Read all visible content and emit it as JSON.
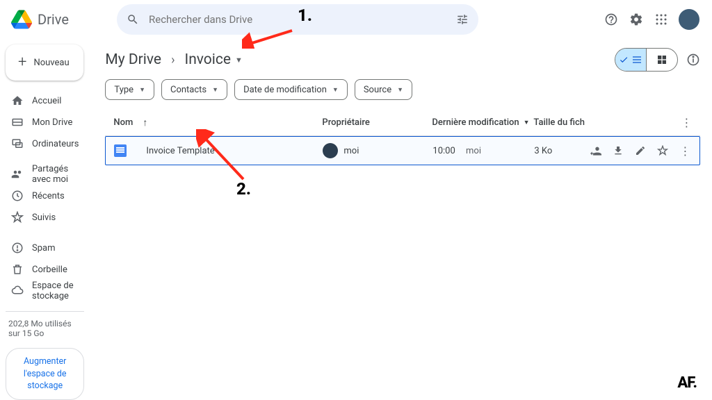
{
  "app": {
    "name": "Drive"
  },
  "search": {
    "placeholder": "Rechercher dans Drive"
  },
  "newButton": {
    "label": "Nouveau"
  },
  "sidebar": {
    "items": [
      {
        "label": "Accueil",
        "icon": "home-icon"
      },
      {
        "label": "Mon Drive",
        "icon": "drive-icon"
      },
      {
        "label": "Ordinateurs",
        "icon": "computers-icon"
      },
      {
        "label": "Partagés avec moi",
        "icon": "shared-icon"
      },
      {
        "label": "Récents",
        "icon": "recent-icon"
      },
      {
        "label": "Suivis",
        "icon": "starred-icon"
      },
      {
        "label": "Spam",
        "icon": "spam-icon"
      },
      {
        "label": "Corbeille",
        "icon": "trash-icon"
      },
      {
        "label": "Espace de stockage",
        "icon": "storage-icon"
      }
    ],
    "storageText": "202,8 Mo utilisés sur 15 Go",
    "storageButton": "Augmenter l'espace de stockage"
  },
  "breadcrumbs": {
    "root": "My Drive",
    "current": "Invoice"
  },
  "chips": [
    {
      "label": "Type"
    },
    {
      "label": "Contacts"
    },
    {
      "label": "Date de modification"
    },
    {
      "label": "Source"
    }
  ],
  "table": {
    "headers": {
      "name": "Nom",
      "owner": "Propriétaire",
      "modified": "Dernière modification",
      "size": "Taille du fich"
    },
    "rows": [
      {
        "name": "Invoice Template",
        "owner": "moi",
        "modifiedTime": "10:00",
        "modifiedBy": "moi",
        "size": "3 Ko"
      }
    ]
  },
  "annotations": {
    "one": "1.",
    "two": "2."
  },
  "watermark": "AF."
}
